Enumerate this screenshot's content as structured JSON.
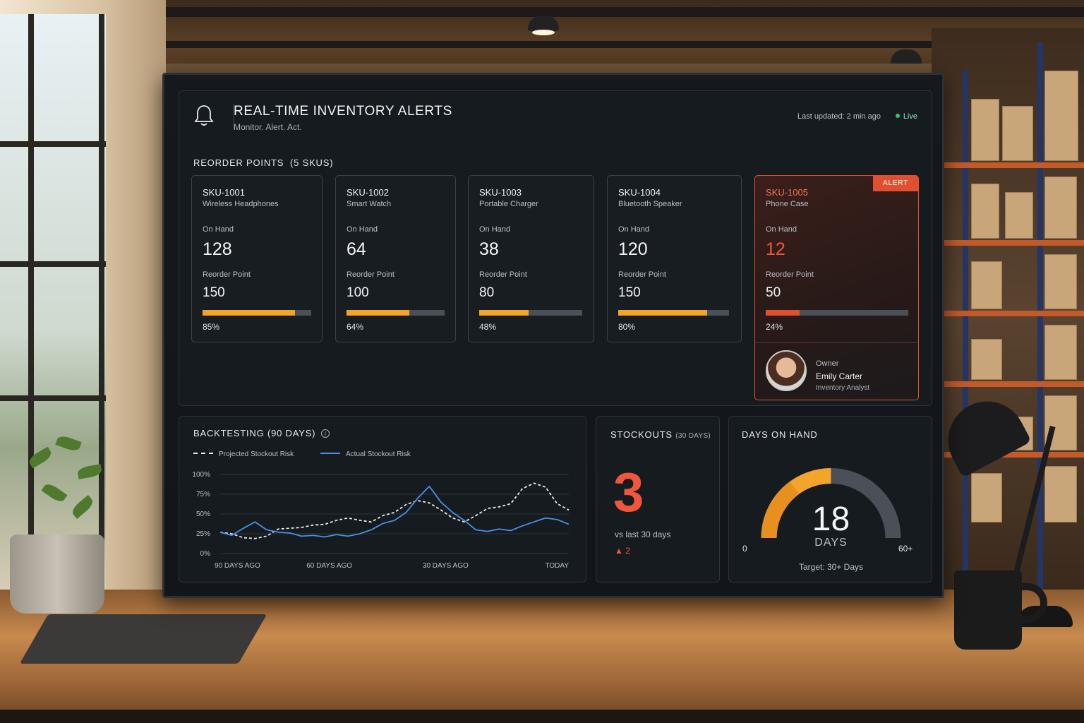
{
  "header": {
    "title": "REAL-TIME INVENTORY ALERTS",
    "subtitle": "Monitor. Alert. Act.",
    "last_updated": "Last updated: 2 min ago",
    "live": "Live"
  },
  "reorder": {
    "title": "REORDER POINTS",
    "count": "(5 SKUS)",
    "on_hand_label": "On Hand",
    "reorder_label": "Reorder Point",
    "skus": [
      {
        "id": "SKU-1001",
        "name": "Wireless Headphones",
        "on_hand": "128",
        "reorder_point": "150",
        "pct": "85%",
        "fill": 0.85
      },
      {
        "id": "SKU-1002",
        "name": "Smart Watch",
        "on_hand": "64",
        "reorder_point": "100",
        "pct": "64%",
        "fill": 0.64
      },
      {
        "id": "SKU-1003",
        "name": "Portable Charger",
        "on_hand": "38",
        "reorder_point": "80",
        "pct": "48%",
        "fill": 0.48
      },
      {
        "id": "SKU-1004",
        "name": "Bluetooth Speaker",
        "on_hand": "120",
        "reorder_point": "150",
        "pct": "80%",
        "fill": 0.8
      },
      {
        "id": "SKU-1005",
        "name": "Phone Case",
        "on_hand": "12",
        "reorder_point": "50",
        "pct": "24%",
        "fill": 0.24,
        "alert": "ALERT"
      }
    ],
    "owner": {
      "label": "Owner",
      "name": "Emily Carter",
      "role": "Inventory Analyst"
    }
  },
  "backtesting": {
    "title": "BACKTESTING (90 DAYS)",
    "info_icon": "info-icon"
  },
  "chart_data": {
    "type": "line",
    "title": "BACKTESTING (90 DAYS)",
    "x_ticks": [
      "90 DAYS AGO",
      "60 DAYS AGO",
      "30 DAYS AGO",
      "TODAY"
    ],
    "y_ticks": [
      "0%",
      "25%",
      "50%",
      "75%",
      "100%"
    ],
    "ylim": [
      0,
      100
    ],
    "x_range": [
      0,
      90
    ],
    "grid": true,
    "legend_position": "top-left",
    "series": [
      {
        "name": "Projected Stockout Risk",
        "style": "dashed",
        "color": "#e8eaed",
        "x": [
          0,
          3,
          6,
          9,
          12,
          15,
          18,
          21,
          24,
          27,
          30,
          33,
          36,
          39,
          42,
          45,
          48,
          51,
          54,
          57,
          60,
          63,
          66,
          69,
          72,
          75,
          78,
          81,
          84,
          87,
          90
        ],
        "y": [
          27,
          25,
          20,
          19,
          22,
          31,
          32,
          33,
          36,
          37,
          42,
          45,
          42,
          40,
          48,
          52,
          62,
          67,
          64,
          55,
          45,
          40,
          48,
          57,
          59,
          63,
          82,
          89,
          84,
          63,
          55
        ]
      },
      {
        "name": "Actual Stockout Risk",
        "style": "solid",
        "color": "#4a90e2",
        "x": [
          0,
          3,
          6,
          9,
          12,
          15,
          18,
          21,
          24,
          27,
          30,
          33,
          36,
          39,
          42,
          45,
          48,
          51,
          54,
          57,
          60,
          63,
          66,
          69,
          72,
          75,
          78,
          81,
          84,
          87,
          90
        ],
        "y": [
          27,
          23,
          32,
          40,
          30,
          27,
          26,
          22,
          23,
          21,
          24,
          22,
          25,
          30,
          38,
          42,
          52,
          70,
          85,
          65,
          52,
          42,
          30,
          28,
          31,
          29,
          35,
          40,
          45,
          43,
          37
        ]
      }
    ]
  },
  "stockouts": {
    "title": "STOCKOUTS",
    "period": "(30 DAYS)",
    "value": "3",
    "vs": "vs last 30 days",
    "delta": "2",
    "delta_icon": "triangle-up-icon"
  },
  "days_on_hand": {
    "title": "DAYS ON HAND",
    "value": "18",
    "unit": "DAYS",
    "min": "0",
    "max": "60+",
    "target": "Target: 30+ Days",
    "level": 0.3,
    "colors": {
      "fill": "#f2a52a",
      "track": "#4a5057"
    }
  },
  "colors": {
    "accent": "#f2a52a",
    "alert": "#e0502f",
    "live": "#35c46f",
    "line_actual": "#4a90e2"
  }
}
